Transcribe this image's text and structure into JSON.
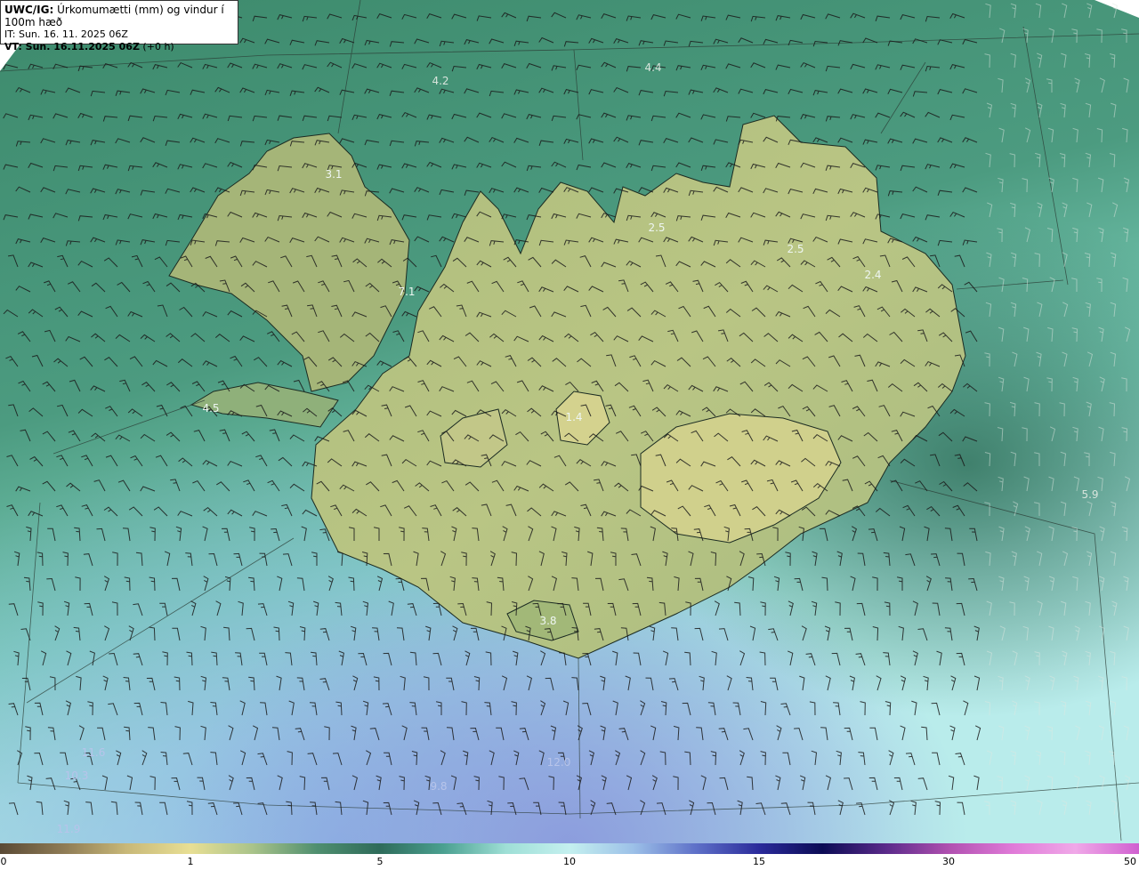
{
  "header": {
    "title_prefix": "UWC/IG:",
    "title_text": " Úrkomumætti (mm) og vindur í 100m hæð",
    "init_time": "IT: Sun. 16. 11. 2025 06Z",
    "valid_prefix": "VT: Sun. 16.11.2025 06Z",
    "valid_suffix": " (+0 h)"
  },
  "labels": [
    {
      "id": "l1",
      "text": "4.2"
    },
    {
      "id": "l2",
      "text": "4.4"
    },
    {
      "id": "l3",
      "text": "3.1"
    },
    {
      "id": "l4",
      "text": "2.5"
    },
    {
      "id": "l5",
      "text": "2.5"
    },
    {
      "id": "l6",
      "text": "2.4"
    },
    {
      "id": "l7",
      "text": "7.1"
    },
    {
      "id": "l8",
      "text": "4.5"
    },
    {
      "id": "l9",
      "text": "1.4"
    },
    {
      "id": "l10",
      "text": "5.9"
    },
    {
      "id": "l11",
      "text": "3.8"
    },
    {
      "id": "l12",
      "text": "11.6"
    },
    {
      "id": "l13",
      "text": "10.3"
    },
    {
      "id": "l14",
      "text": "12.0"
    },
    {
      "id": "l15",
      "text": "9.8"
    },
    {
      "id": "l16",
      "text": "11.9"
    }
  ],
  "colorbar": {
    "ticks": [
      "0",
      "1",
      "5",
      "10",
      "15",
      "30",
      "50"
    ],
    "colors": [
      "#5a4a35",
      "#8e7b55",
      "#c8b878",
      "#e8df94",
      "#a9c38a",
      "#4f8f6f",
      "#2e6b5a",
      "#4aa090",
      "#9edfd6",
      "#c4f0ef",
      "#9cc0e8",
      "#5e70c8",
      "#2a2a9a",
      "#0b0b55",
      "#5a2a8a",
      "#b050b0",
      "#e07ad8",
      "#f0a8e8",
      "#d060d0"
    ]
  }
}
